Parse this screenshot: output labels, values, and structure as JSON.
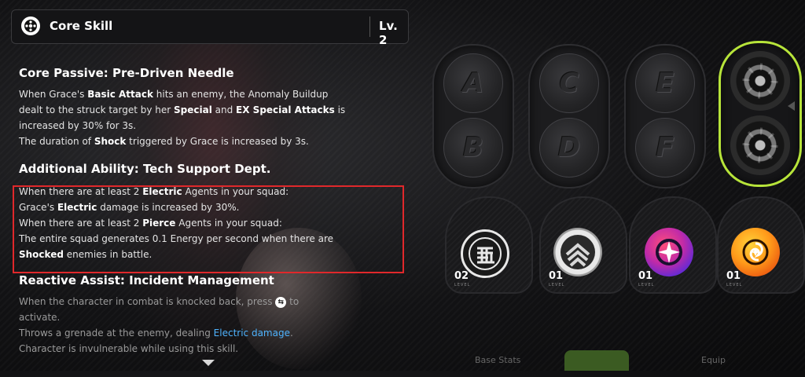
{
  "header": {
    "title": "Core Skill",
    "level": "Lv. 2",
    "icon": "core-skill-icon"
  },
  "core_passive": {
    "title": "Core Passive: Pre-Driven Needle",
    "l1_a": "When Grace's ",
    "l1_b": "Basic Attack",
    "l1_c": " hits an enemy, the Anomaly Buildup",
    "l2_a": "dealt to the struck target by her ",
    "l2_b": "Special",
    "l2_c": " and ",
    "l2_d": "EX Special Attacks",
    "l2_e": " is",
    "l3": "increased by 30% for 3s.",
    "l4_a": "The duration of ",
    "l4_b": "Shock",
    "l4_c": " triggered by Grace is increased by 3s."
  },
  "additional": {
    "title": "Additional Ability: Tech Support Dept.",
    "l1_a": "When there are at least 2 ",
    "l1_b": "Electric",
    "l1_c": " Agents in your squad:",
    "l2_a": "Grace's ",
    "l2_b": "Electric",
    "l2_c": " damage is increased by 30%.",
    "l3_a": "When there are at least 2 ",
    "l3_b": "Pierce",
    "l3_c": " Agents in your squad:",
    "l4": "The entire squad generates 0.1 Energy per second when there are",
    "l5_a": "Shocked",
    "l5_b": " enemies in battle."
  },
  "reactive": {
    "title": "Reactive Assist: Incident Management",
    "l1_a": "When the character in combat is knocked back, press ",
    "l1_b": " to",
    "l2": "activate.",
    "l3_a": "Throws a grenade at the enemy, dealing ",
    "l3_b": "Electric damage",
    "l3_c": ".",
    "l4": "Character is invulnerable while using this skill."
  },
  "skill_pills": [
    {
      "top": "A",
      "bottom": "B"
    },
    {
      "top": "C",
      "bottom": "D"
    },
    {
      "top": "E",
      "bottom": "F"
    }
  ],
  "slots": [
    {
      "level": "02",
      "level_label": "LEVEL",
      "icon": "physical-fist-icon"
    },
    {
      "level": "01",
      "level_label": "LEVEL",
      "icon": "pierce-chevron-icon"
    },
    {
      "level": "01",
      "level_label": "LEVEL",
      "icon": "anomaly-star-icon"
    },
    {
      "level": "01",
      "level_label": "LEVEL",
      "icon": "support-swirl-icon"
    }
  ],
  "bottom_tabs": [
    "Base Stats",
    "Equip"
  ],
  "colors": {
    "accent_green": "#b7e43a",
    "electric_blue": "#4fb4ff",
    "highlight_red": "#e0282b"
  }
}
